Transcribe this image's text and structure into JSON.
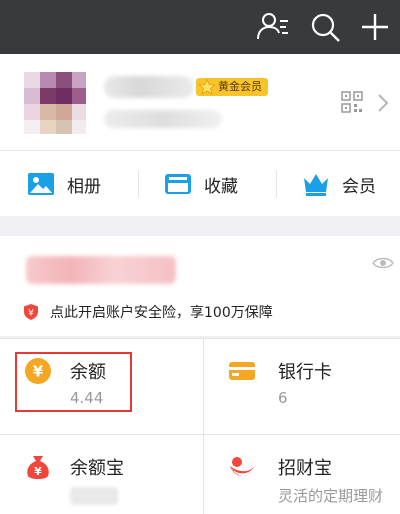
{
  "topbar": {
    "icons": [
      "contacts-icon",
      "search-icon",
      "add-icon"
    ],
    "background": "#373b3e"
  },
  "profile": {
    "member_badge": "黄金会员"
  },
  "shortcuts": {
    "album": "相册",
    "favorites": "收藏",
    "vip": "会员"
  },
  "assets": {
    "insurance_text": "点此开启账户安全险，享100万保障"
  },
  "grid": {
    "balance": {
      "title": "余额",
      "value": "4.44"
    },
    "bank_card": {
      "title": "银行卡",
      "value": "6"
    },
    "yuebao": {
      "title": "余额宝"
    },
    "zhaocaibao": {
      "title": "招财宝",
      "subtitle": "灵活的定期理财"
    }
  },
  "colors": {
    "accent_blue": "#1aa0e6",
    "highlight_red": "#e53935",
    "gold": "#f7c42b",
    "orange": "#f5a623",
    "red": "#f0463c"
  }
}
